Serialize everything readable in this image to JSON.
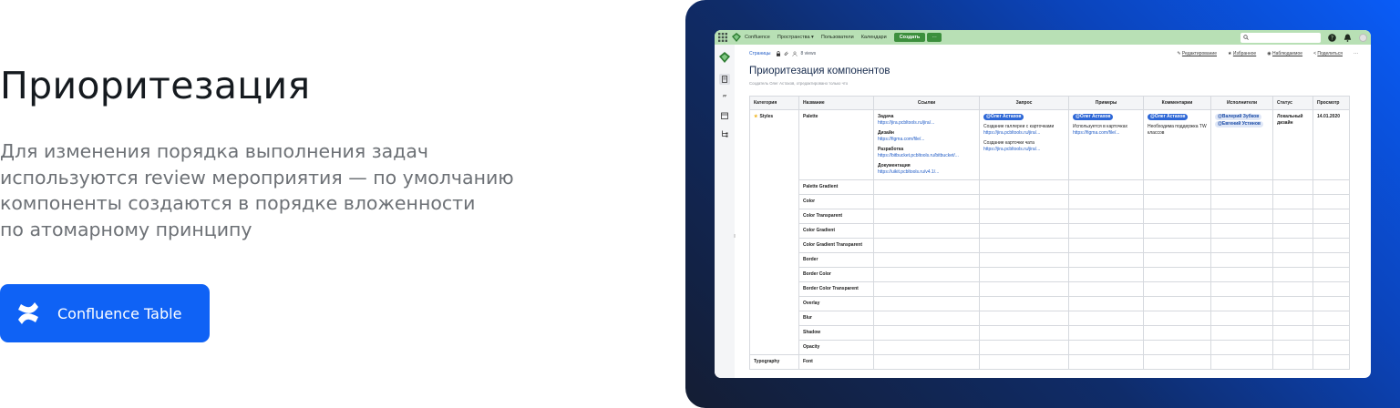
{
  "hero": {
    "title": "Приоритезация",
    "description": [
      "Для изменения порядка выполнения задач",
      "используются review мероприятия — по умолчанию",
      "компоненты создаются в порядке вложенности",
      "по атомарному принципу"
    ],
    "cta_label": "Confluence Table",
    "cta_icon": "confluence-logo-icon",
    "cta_color": "#0f62f5"
  },
  "confluence": {
    "topbar": {
      "app_name": "Confluence",
      "nav": [
        "Пространства ▾",
        "Пользователи",
        "Календари"
      ],
      "create_label": "Создать",
      "more_label": "···",
      "search_placeholder": "",
      "bar_color": "#b8e0b5"
    },
    "breadcrumb": {
      "root": "Страницы",
      "views": "8 views"
    },
    "actions": [
      "Редактирование",
      "Избранное",
      "Наблюдаемое",
      "Поделиться",
      "···"
    ],
    "page_title": "Приоритезация компонентов",
    "byline": "Создатель Олег Астахов, отредактировано только что",
    "table": {
      "headers": [
        "Категория",
        "Название",
        "Ссылки",
        "Запрос",
        "Примеры",
        "Комментарии",
        "Исполнители",
        "Статус",
        "Просмотр"
      ],
      "first_row": {
        "category": "Styles",
        "name": "Palette",
        "links": [
          {
            "label": "Задача",
            "url": "https://jira.pcbltools.ru/jira/..."
          },
          {
            "label": "Дизайн",
            "url": "https://figma.com/file/..."
          },
          {
            "label": "Разработка",
            "url": "https://bitbucket.pcbltools.ru/bitbucket/..."
          },
          {
            "label": "Документация",
            "url": "https://uikit.pcbltools.ru/v4.1/..."
          }
        ],
        "request": {
          "mention": "@Олег Астахов",
          "items": [
            {
              "text": "Создание галлереи с карточками",
              "url": "https://jira.pcbltools.ru/jira/..."
            },
            {
              "text": "Создание карточки чата",
              "url": "https://jira.pcbltools.ru/jira/..."
            }
          ]
        },
        "examples": {
          "mention": "@Олег Астахов",
          "text": "Используется в карточках",
          "url": "https://figma.com/file/..."
        },
        "comments": {
          "mention": "@Олег Астахов",
          "text": "Необходима поддержка TW классов"
        },
        "assignees": [
          "@Валерий Зубков",
          "@Евгений Устинов"
        ],
        "status": "Локальный дизайн",
        "review": "14.01.2020"
      },
      "rows": [
        "Palette Gradient",
        "Color",
        "Color Transparent",
        "Color Gradient",
        "Color Gradient Transparent",
        "Border",
        "Border Color",
        "Border Color Transparent",
        "Overlay",
        "Blur",
        "Shadow",
        "Opacity"
      ],
      "next_category": "Typography",
      "next_name": "Font"
    }
  }
}
